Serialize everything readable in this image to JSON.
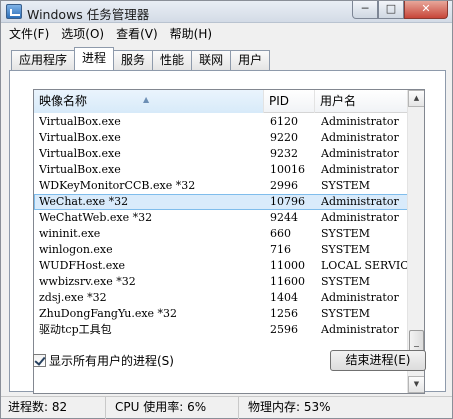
{
  "window": {
    "title": "Windows 任务管理器",
    "minimize_glyph": "─",
    "maximize_glyph": "□",
    "close_glyph": "✕"
  },
  "menu": [
    "文件(F)",
    "选项(O)",
    "查看(V)",
    "帮助(H)"
  ],
  "tabs": [
    {
      "label": "应用程序",
      "active": false
    },
    {
      "label": "进程",
      "active": true
    },
    {
      "label": "服务",
      "active": false
    },
    {
      "label": "性能",
      "active": false
    },
    {
      "label": "联网",
      "active": false
    },
    {
      "label": "用户",
      "active": false
    }
  ],
  "columns": {
    "name": "映像名称",
    "pid": "PID",
    "user": "用户名"
  },
  "processes": [
    {
      "name": "VirtualBox.exe",
      "pid": "6120",
      "user": "Administrator"
    },
    {
      "name": "VirtualBox.exe",
      "pid": "9220",
      "user": "Administrator"
    },
    {
      "name": "VirtualBox.exe",
      "pid": "9232",
      "user": "Administrator"
    },
    {
      "name": "VirtualBox.exe",
      "pid": "10016",
      "user": "Administrator"
    },
    {
      "name": "WDKeyMonitorCCB.exe *32",
      "pid": "2996",
      "user": "SYSTEM"
    },
    {
      "name": "WeChat.exe *32",
      "pid": "10796",
      "user": "Administrator",
      "selected": true
    },
    {
      "name": "WeChatWeb.exe *32",
      "pid": "9244",
      "user": "Administrator"
    },
    {
      "name": "wininit.exe",
      "pid": "660",
      "user": "SYSTEM"
    },
    {
      "name": "winlogon.exe",
      "pid": "716",
      "user": "SYSTEM"
    },
    {
      "name": "WUDFHost.exe",
      "pid": "11000",
      "user": "LOCAL SERVICE"
    },
    {
      "name": "wwbizsrv.exe *32",
      "pid": "11600",
      "user": "SYSTEM"
    },
    {
      "name": "zdsj.exe *32",
      "pid": "1404",
      "user": "Administrator"
    },
    {
      "name": "ZhuDongFangYu.exe *32",
      "pid": "1256",
      "user": "SYSTEM"
    },
    {
      "name": "驱动tcp工具包",
      "pid": "2596",
      "user": "Administrator"
    }
  ],
  "show_all_users": {
    "label": "显示所有用户的进程(S)",
    "checked": true
  },
  "end_process_label": "结束进程(E)",
  "status": {
    "processes": "进程数: 82",
    "cpu": "CPU 使用率: 6%",
    "memory": "物理内存: 53%"
  },
  "icons": {
    "app": "task-manager-icon",
    "sort": "sort-ascending-icon"
  }
}
